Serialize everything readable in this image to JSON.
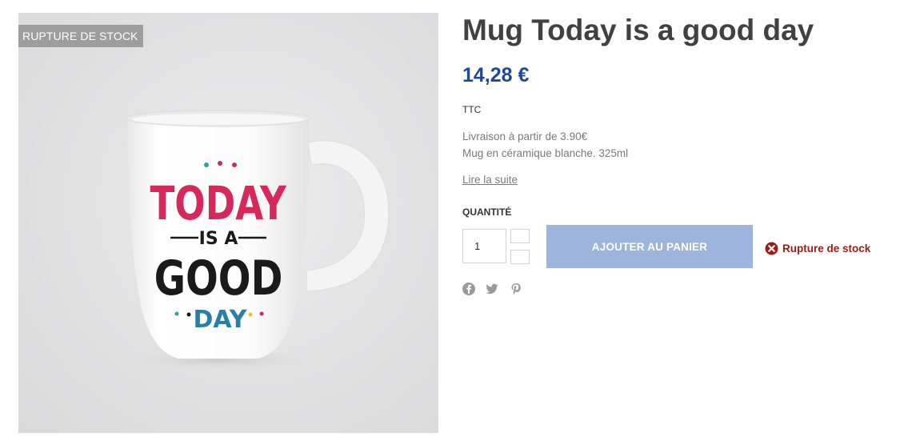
{
  "product": {
    "badge": "RUPTURE DE STOCK",
    "title": "Mug Today is a good day",
    "price": "14,28 €",
    "tax_label": "TTC",
    "description": [
      "Livraison à partir de 3.90€",
      "Mug en céramique blanche. 325ml"
    ],
    "read_more": "Lire la suite"
  },
  "mug_print": {
    "line1": "TODAY",
    "line2": "IS A",
    "line3": "GOOD",
    "line4": "DAY"
  },
  "purchase": {
    "quantity_label": "QUANTITÉ",
    "quantity_value": "1",
    "add_to_cart": "AJOUTER AU PANIER",
    "availability": "Rupture de stock"
  },
  "social": [
    "facebook-icon",
    "twitter-icon",
    "pinterest-icon"
  ],
  "colors": {
    "price": "#1e4a95",
    "button": "#9db5dc",
    "out_of_stock": "#9b1b1b",
    "badge": "#9d9d9d",
    "today_pink": "#d6285a",
    "day_blue": "#2a7fa6"
  }
}
